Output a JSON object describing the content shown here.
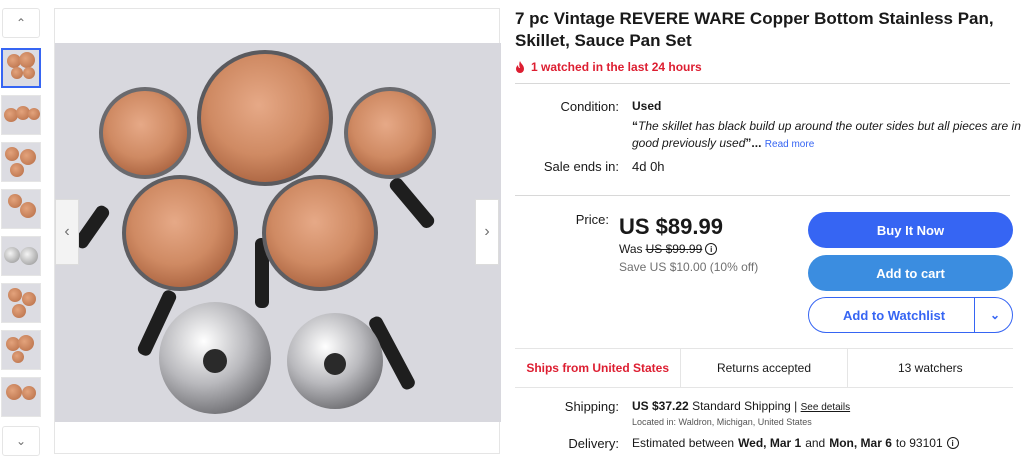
{
  "gallery": {
    "thumb_count": 8,
    "active_index": 0
  },
  "listing": {
    "title": "7 pc Vintage REVERE WARE Copper Bottom Stainless Pan, Skillet, Sauce Pan Set",
    "watched_text": "1 watched in the last 24 hours",
    "condition_label": "Condition:",
    "condition_value": "Used",
    "condition_note": "The skillet has black build up around the outer sides but all pieces are in good previously used",
    "quote_open": "“",
    "quote_close": "”",
    "ellipsis": "...",
    "read_more": "Read more",
    "sale_ends_label": "Sale ends in:",
    "sale_ends_value": "4d 0h"
  },
  "pricing": {
    "price_label": "Price:",
    "price": "US $89.99",
    "was_label": "Was",
    "was_price": "US $99.99",
    "save_text": "Save US $10.00 (10% off)"
  },
  "actions": {
    "buy_now": "Buy It Now",
    "add_to_cart": "Add to cart",
    "add_to_watchlist": "Add to Watchlist"
  },
  "badges": {
    "ships_from": "Ships from United States",
    "returns": "Returns accepted",
    "watchers": "13 watchers"
  },
  "shipping": {
    "label": "Shipping:",
    "cost": "US $37.22",
    "method": "Standard Shipping",
    "separator": "|",
    "see_details": "See details",
    "location": "Located in: Waldron, Michigan, United States"
  },
  "delivery": {
    "label": "Delivery:",
    "prefix": "Estimated between",
    "start": "Wed, Mar 1",
    "and": "and",
    "end": "Mon, Mar 6",
    "to": "to 93101"
  },
  "colors": {
    "primary_blue": "#3665f3",
    "cart_blue": "#3b8de0",
    "alert_red": "#dd1e31"
  },
  "icons": {
    "fire": "fire-icon",
    "info": "info-icon",
    "chevron_up": "chevron-up-icon",
    "chevron_down": "chevron-down-icon",
    "chevron_left": "chevron-left-icon",
    "chevron_right": "chevron-right-icon"
  }
}
